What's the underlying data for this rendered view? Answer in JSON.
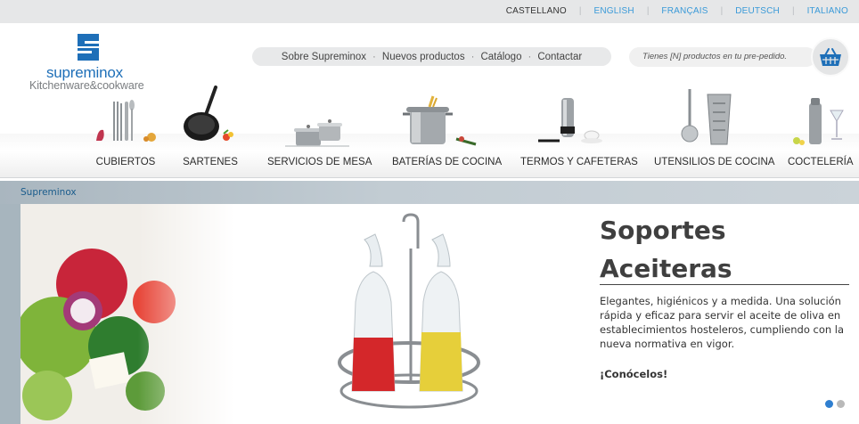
{
  "languages": [
    {
      "label": "CASTELLANO",
      "active": true
    },
    {
      "label": "ENGLISH",
      "active": false
    },
    {
      "label": "FRANÇAIS",
      "active": false
    },
    {
      "label": "DEUTSCH",
      "active": false
    },
    {
      "label": "ITALIANO",
      "active": false
    }
  ],
  "logo": {
    "brand": "supreminox",
    "tagline": "Kitchenware&cookware"
  },
  "top_nav": [
    "Sobre Supreminox",
    "Nuevos productos",
    "Catálogo",
    "Contactar"
  ],
  "cart": {
    "text": "Tienes [N] productos en tu pre-pedido.",
    "icon": "basket-icon"
  },
  "categories": [
    {
      "label": "CUBIERTOS",
      "icon": "cutlery-icon"
    },
    {
      "label": "SARTENES",
      "icon": "frying-pan-icon"
    },
    {
      "label": "SERVICIOS DE MESA",
      "icon": "serving-pots-icon"
    },
    {
      "label": "BATERÍAS DE COCINA",
      "icon": "stock-pot-icon"
    },
    {
      "label": "TERMOS Y CAFETERAS",
      "icon": "thermos-icon"
    },
    {
      "label": "UTENSILIOS DE COCINA",
      "icon": "grater-icon"
    },
    {
      "label": "COCTELERÍA",
      "icon": "cocktail-shaker-icon"
    }
  ],
  "breadcrumb": "Supreminox",
  "slide": {
    "title_line1": "Soportes",
    "title_line2": "Aceiteras",
    "description": "Elegantes, higiénicos y a medida. Una solución rápida y eficaz para servir el aceite de oliva en establecimientos hosteleros, cumpliendo con la nueva normativa en vigor.",
    "cta": "¡Conócelos!",
    "slide_count": 2,
    "active_slide": 1
  },
  "colors": {
    "brand_blue": "#1e6fb8",
    "link_blue": "#3a9ad8",
    "active_dot": "#2f7fd0"
  }
}
